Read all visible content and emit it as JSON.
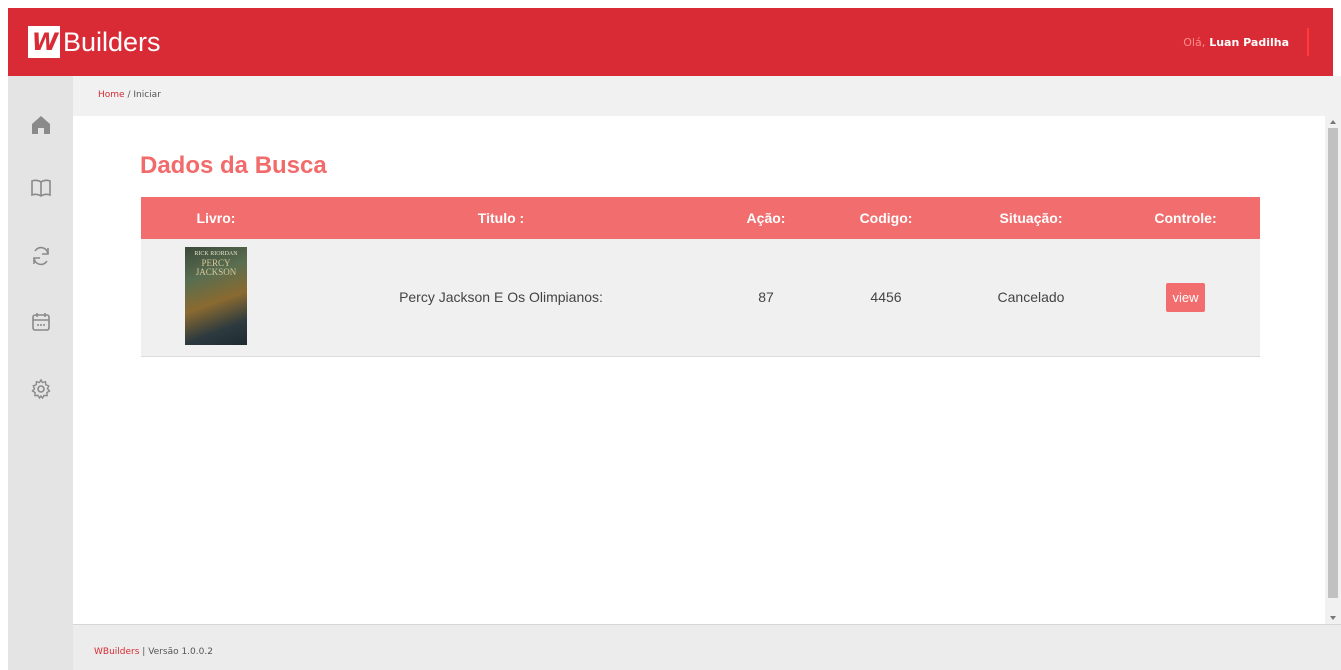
{
  "header": {
    "logo_mark": "W",
    "brand_name": "Builders",
    "greeting": "Olá,",
    "user_name": "Luan Padilha"
  },
  "sidebar": {
    "items": [
      {
        "icon": "home-icon"
      },
      {
        "icon": "book-icon"
      },
      {
        "icon": "refresh-icon"
      },
      {
        "icon": "calendar-icon"
      },
      {
        "icon": "gear-icon"
      }
    ]
  },
  "breadcrumb": {
    "home": "Home",
    "separator": "/",
    "current": "Iniciar"
  },
  "main": {
    "title": "Dados da Busca",
    "table": {
      "headers": [
        "Livro:",
        "Titulo :",
        "Ação:",
        "Codigo:",
        "Situação:",
        "Controle:"
      ],
      "rows": [
        {
          "cover_author": "RICK RIORDAN",
          "cover_series": "PERCY JACKSON",
          "titulo": "Percy Jackson E Os Olimpianos:",
          "acao": "87",
          "codigo": "4456",
          "situacao": "Cancelado",
          "controle": "view"
        }
      ]
    }
  },
  "footer": {
    "brand": "WBuilders",
    "version": "| Versão 1.0.0.2"
  },
  "colors": {
    "primary": "#d92b35",
    "accent": "#f26d6d"
  }
}
